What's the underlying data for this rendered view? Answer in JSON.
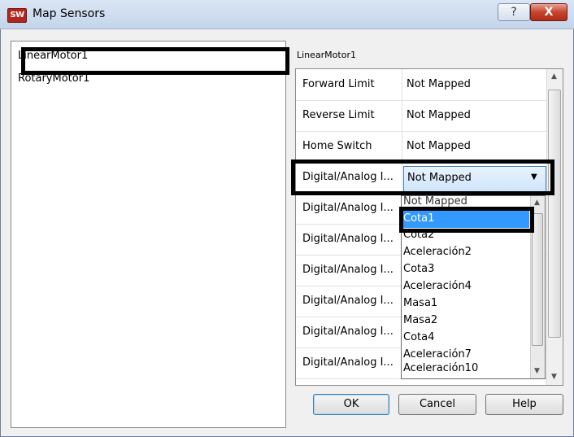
{
  "window": {
    "title": "Map Sensors",
    "app_icon_text": "SW",
    "help_glyph": "?",
    "close_glyph": "X"
  },
  "motors": [
    "LinearMotor1",
    "RotaryMotor1"
  ],
  "panel": {
    "heading": "LinearMotor1"
  },
  "sensor_rows": [
    {
      "label": "Forward Limit",
      "value": "Not Mapped"
    },
    {
      "label": "Reverse Limit",
      "value": "Not Mapped"
    },
    {
      "label": "Home Switch",
      "value": "Not Mapped"
    },
    {
      "label": "Digital/Analog I...",
      "value": "Not Mapped"
    },
    {
      "label": "Digital/Analog I...",
      "value": ""
    },
    {
      "label": "Digital/Analog I...",
      "value": ""
    },
    {
      "label": "Digital/Analog I...",
      "value": ""
    },
    {
      "label": "Digital/Analog I...",
      "value": ""
    },
    {
      "label": "Digital/Analog I...",
      "value": ""
    },
    {
      "label": "Digital/Analog I...",
      "value": ""
    }
  ],
  "dropdown": {
    "current_value": "Not Mapped",
    "selected_option": "Cota1",
    "options": [
      "Not Mapped",
      "Cota1",
      "Cota2",
      "Aceleración2",
      "Cota3",
      "Aceleración4",
      "Masa1",
      "Masa2",
      "Cota4",
      "Aceleración7",
      "Aceleración10"
    ]
  },
  "buttons": {
    "ok": "OK",
    "cancel": "Cancel",
    "help": "Help"
  },
  "colors": {
    "selection": "#3399ff",
    "combo_border": "#3c7fb1",
    "highlight_box": "#000000"
  }
}
